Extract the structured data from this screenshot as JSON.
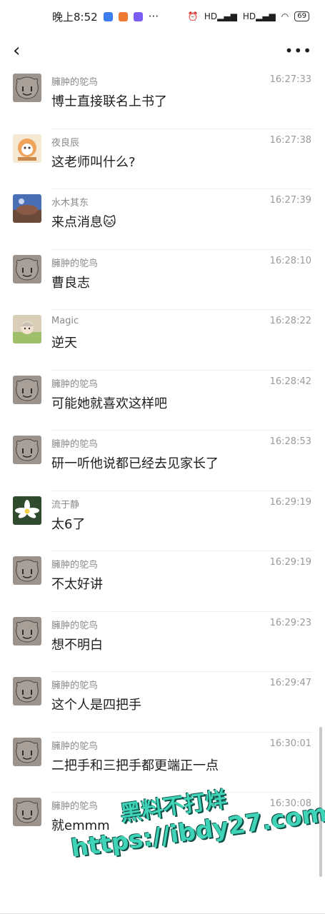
{
  "status_bar": {
    "time": "晚上8:52",
    "dots": "···",
    "network_1": "HD",
    "network_2": "HD",
    "battery": "69"
  },
  "nav": {
    "more": "•••"
  },
  "messages": [
    {
      "sender": "臃肿的鸵鸟",
      "time": "16:27:33",
      "text": "博士直接联名上书了",
      "avatar": "bear"
    },
    {
      "sender": "夜良辰",
      "time": "16:27:38",
      "text": "这老师叫什么?",
      "avatar": "cartoon"
    },
    {
      "sender": "水木其东",
      "time": "16:27:39",
      "text": "来点消息",
      "avatar": "photo",
      "emoji": "🐱"
    },
    {
      "sender": "臃肿的鸵鸟",
      "time": "16:28:10",
      "text": "曹良志",
      "avatar": "bear"
    },
    {
      "sender": "Magic",
      "time": "16:28:22",
      "text": "逆天",
      "avatar": "anime"
    },
    {
      "sender": "臃肿的鸵鸟",
      "time": "16:28:42",
      "text": "可能她就喜欢这样吧",
      "avatar": "bear"
    },
    {
      "sender": "臃肿的鸵鸟",
      "time": "16:28:53",
      "text": "研一听他说都已经去见家长了",
      "avatar": "bear"
    },
    {
      "sender": "流于静",
      "time": "16:29:19",
      "text": "太6了",
      "avatar": "flower"
    },
    {
      "sender": "臃肿的鸵鸟",
      "time": "16:29:19",
      "text": "不太好讲",
      "avatar": "bear"
    },
    {
      "sender": "臃肿的鸵鸟",
      "time": "16:29:23",
      "text": "想不明白",
      "avatar": "bear"
    },
    {
      "sender": "臃肿的鸵鸟",
      "time": "16:29:47",
      "text": "这个人是四把手",
      "avatar": "bear"
    },
    {
      "sender": "臃肿的鸵鸟",
      "time": "16:30:01",
      "text": "二把手和三把手都更端正一点",
      "avatar": "bear"
    },
    {
      "sender": "臃肿的鸵鸟",
      "time": "16:30:08",
      "text": "就emmm",
      "avatar": "bear"
    }
  ],
  "watermark": {
    "line1": "黑料不打烊",
    "line2": "https://ibdy27.com"
  },
  "colors": {
    "watermark": "#3fd4b8",
    "watermark_shadow": "#0f4f45",
    "meta_text": "#8a8a8a"
  }
}
